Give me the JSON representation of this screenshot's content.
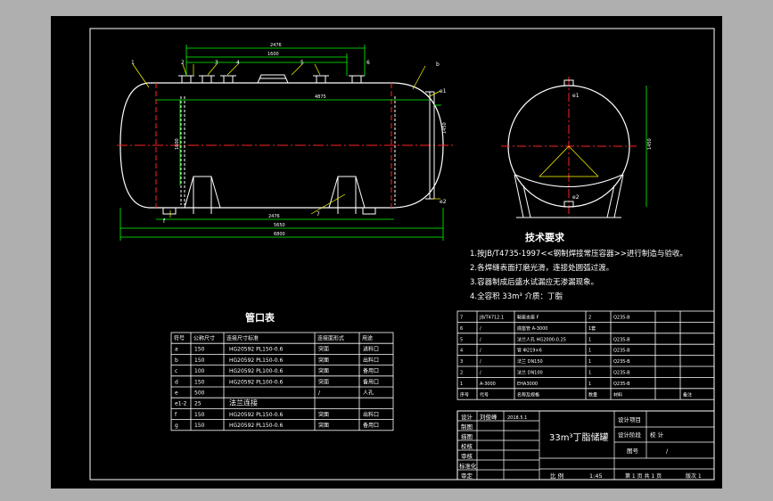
{
  "colors": {
    "background": "#000000",
    "frame": "#ffffff",
    "dimension": "#00ff00",
    "centerline": "#ff2020",
    "leader": "#ffff00",
    "outline": "#ffffff",
    "title_text": "#ffffff"
  },
  "front_view": {
    "dims": [
      "2476",
      "1600",
      "4875",
      "2476",
      "5650",
      "6800"
    ],
    "height_dims": [
      "1600",
      "1450"
    ],
    "marks": [
      "f",
      "e1",
      "e2",
      "b",
      "1",
      "2",
      "3",
      "4",
      "5",
      "6",
      "7"
    ]
  },
  "side_view": {
    "labels": [
      "e1",
      "e2"
    ],
    "dims": [
      "1450"
    ]
  },
  "tech_requirements": {
    "title": "技术要求",
    "items": [
      "1.按JB/T4735-1997<<钢制焊接常压容器>>进行制造与验收。",
      "2.各焊缝表面打磨光滑，连接处圆弧过渡。",
      "3.容器制成后盛水试漏应无渗漏现象。",
      "4.全容积 33m³   介质：丁脂"
    ]
  },
  "nozzle_table": {
    "title": "管口表",
    "headers": [
      "符号",
      "公称尺寸",
      "连接尺寸标准",
      "连接面形式",
      "用途"
    ],
    "rows": [
      [
        "a",
        "150",
        "HG20592 PL150-0.6",
        "突面",
        "进料口"
      ],
      [
        "b",
        "150",
        "HG20592 PL150-0.6",
        "突面",
        "出料口"
      ],
      [
        "c",
        "100",
        "HG20592 PL100-0.6",
        "突面",
        "备用口"
      ],
      [
        "d",
        "150",
        "HG20592 PL100-0.6",
        "突面",
        "备用口"
      ],
      [
        "e",
        "500",
        "",
        "/",
        "人孔"
      ],
      [
        "e1-2",
        "25",
        "法兰连接",
        "",
        ""
      ],
      [
        "f",
        "150",
        "HG20592 PL150-0.6",
        "突面",
        "出料口"
      ],
      [
        "g",
        "150",
        "HG20592 PL150-0.6",
        "突面",
        "备用口"
      ]
    ]
  },
  "parts_list": {
    "headers": [
      "序号",
      "代号",
      "名称及规格",
      "数量",
      "材料",
      "备注"
    ],
    "rows": [
      [
        "7",
        "JB/T4712.1",
        "鞍座支座 F",
        "2",
        "Q235-B",
        ""
      ],
      [
        "6",
        "/",
        "底座管 A-3000",
        "1套",
        "",
        ""
      ],
      [
        "5",
        "/",
        "法兰人孔 HG2000-0.25",
        "1",
        "Q235-B",
        ""
      ],
      [
        "4",
        "/",
        "管 Ф219×6",
        "1",
        "Q235-B",
        ""
      ],
      [
        "3",
        "/",
        "法兰 DN150",
        "1",
        "Q235-B",
        ""
      ],
      [
        "2",
        "/",
        "法兰 DN100",
        "1",
        "Q235-B",
        ""
      ],
      [
        "1",
        "A-3000",
        "EHA3000",
        "1",
        "Q235-B",
        ""
      ]
    ]
  },
  "title_block": {
    "drawing_name": "33m³丁脂储罐",
    "left_labels": [
      "设计",
      "制图",
      "描图",
      "校核",
      "审核",
      "标准化",
      "审定"
    ],
    "designer": "刘俊峰",
    "date": "2018.5.1",
    "right_labels": [
      "设计项目",
      "设计阶段",
      "图号"
    ],
    "design_check": "校  计",
    "drawing_no": "/",
    "scale_label": "比 例",
    "scale_value": "1:45",
    "sheets": "第 1 页  共 1 页",
    "version": "版次 1"
  }
}
